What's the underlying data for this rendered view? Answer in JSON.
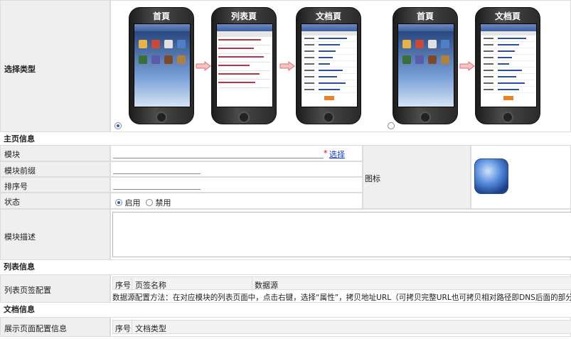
{
  "select_type": {
    "label": "选择类型",
    "option_a": {
      "phones": [
        {
          "title": "首頁",
          "screen": "home"
        },
        {
          "title": "列表頁",
          "screen": "list"
        },
        {
          "title": "文档頁",
          "screen": "doc"
        }
      ],
      "selected": true
    },
    "option_b": {
      "phones": [
        {
          "title": "首頁",
          "screen": "home"
        },
        {
          "title": "文档頁",
          "screen": "doc"
        }
      ],
      "selected": false
    }
  },
  "home_section": {
    "title": "主页信息",
    "module_label": "模块",
    "module_required": "*",
    "module_select_link": "选择",
    "prefix_label": "模块前缀",
    "order_label": "排序号",
    "status_label": "状态",
    "status_enable": "启用",
    "status_disable": "禁用",
    "status_value": "启用",
    "icon_label": "图标",
    "desc_label": "模块描述"
  },
  "list_section": {
    "title": "列表信息",
    "config_label": "列表页签配置",
    "columns": [
      "序号",
      "页签名称",
      "数据源"
    ],
    "hint": "数据源配置方法：在对应模块的列表页面中，点击右键，选择“属性”，拷贝地址URL（可拷贝完整URL也可拷贝相对路径即DNS后面的部分）"
  },
  "doc_section": {
    "title": "文档信息",
    "config_label": "展示页面配置信息",
    "columns": [
      "序号",
      "文档类型"
    ]
  },
  "colors": {
    "label_bg": "#efefef",
    "border": "#dcdcdc",
    "link": "#1a3cc4",
    "required": "#e00000"
  }
}
